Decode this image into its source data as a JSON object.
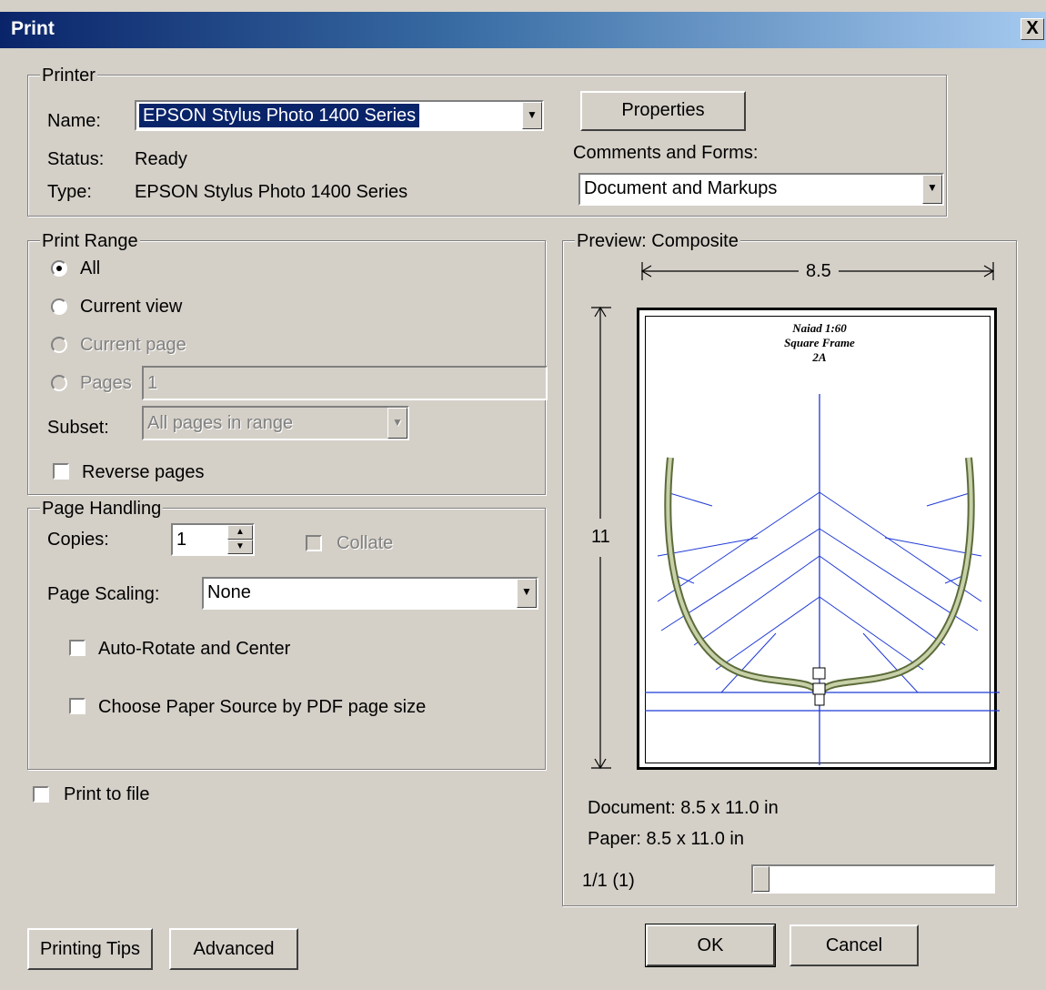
{
  "window": {
    "title": "Print",
    "close_glyph": "X"
  },
  "printer": {
    "legend": "Printer",
    "name_label": "Name:",
    "name_value": "EPSON Stylus Photo 1400 Series",
    "status_label": "Status:",
    "status_value": "Ready",
    "type_label": "Type:",
    "type_value": "EPSON Stylus Photo 1400 Series",
    "properties_label": "Properties",
    "comments_label": "Comments and Forms:",
    "comments_value": "Document and Markups"
  },
  "print_range": {
    "legend": "Print Range",
    "all_label": "All",
    "current_view_label": "Current view",
    "current_page_label": "Current page",
    "pages_label": "Pages",
    "pages_value": "1",
    "subset_label": "Subset:",
    "subset_value": "All pages in range",
    "reverse_label": "Reverse pages",
    "selected": "All"
  },
  "page_handling": {
    "legend": "Page Handling",
    "copies_label": "Copies:",
    "copies_value": "1",
    "collate_label": "Collate",
    "scaling_label": "Page Scaling:",
    "scaling_value": "None",
    "autorotate_label": "Auto-Rotate and Center",
    "paper_source_label": "Choose Paper Source by PDF page size"
  },
  "print_to_file_label": "Print to file",
  "preview": {
    "legend": "Preview: Composite",
    "width_label": "8.5",
    "height_label": "11",
    "page_title_1": "Naiad 1:60",
    "page_title_2": "Square Frame",
    "page_title_3": "2A",
    "doc_label": "Document: 8.5 x 11.0 in",
    "paper_label": "Paper: 8.5 x 11.0 in",
    "page_counter": "1/1 (1)",
    "page_fraction": 0
  },
  "buttons": {
    "printing_tips": "Printing Tips",
    "advanced": "Advanced",
    "ok": "OK",
    "cancel": "Cancel"
  },
  "colors": {
    "titlebar": "#0a246a",
    "hull": "#5b6b3a",
    "frames": "#1f3ad6"
  }
}
